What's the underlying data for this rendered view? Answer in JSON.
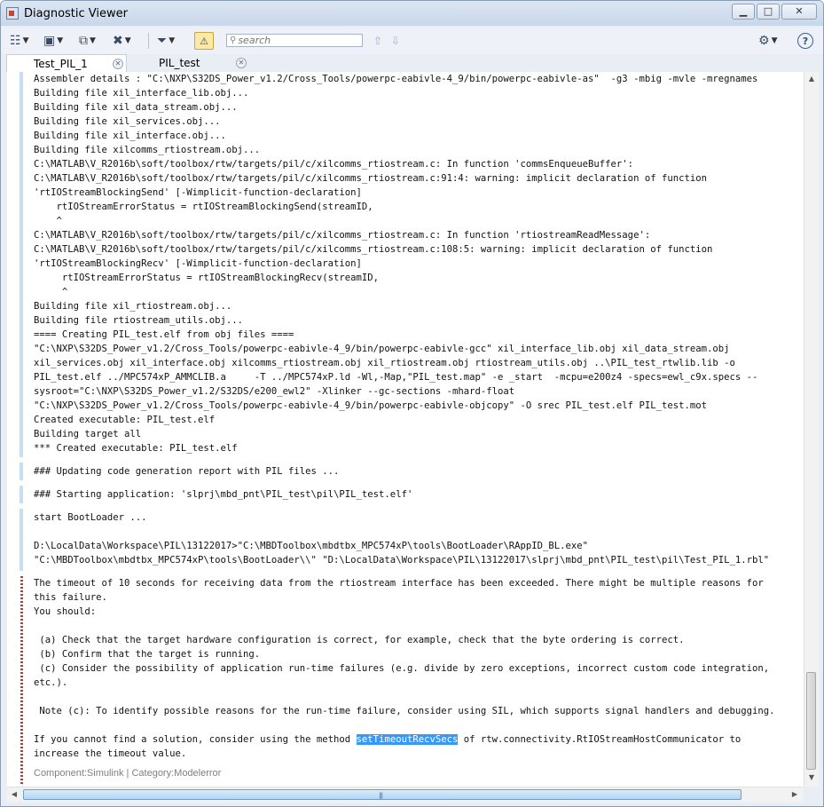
{
  "window": {
    "title": "Diagnostic Viewer"
  },
  "search": {
    "placeholder": "search"
  },
  "tabs": [
    {
      "label": "Test_PIL_1"
    },
    {
      "label": "PIL_test"
    }
  ],
  "blocks": {
    "build": [
      "Assembler details : \"C:\\NXP\\S32DS_Power_v1.2/Cross_Tools/powerpc-eabivle-4_9/bin/powerpc-eabivle-as\"  -g3 -mbig -mvle -mregnames",
      "Building file xil_interface_lib.obj...",
      "Building file xil_data_stream.obj...",
      "Building file xil_services.obj...",
      "Building file xil_interface.obj...",
      "Building file xilcomms_rtiostream.obj...",
      "C:\\MATLAB\\V_R2016b\\soft/toolbox/rtw/targets/pil/c/xilcomms_rtiostream.c: In function 'commsEnqueueBuffer':",
      "C:\\MATLAB\\V_R2016b\\soft/toolbox/rtw/targets/pil/c/xilcomms_rtiostream.c:91:4: warning: implicit declaration of function",
      "'rtIOStreamBlockingSend' [-Wimplicit-function-declaration]",
      "    rtIOStreamErrorStatus = rtIOStreamBlockingSend(streamID,",
      "    ^",
      "C:\\MATLAB\\V_R2016b\\soft/toolbox/rtw/targets/pil/c/xilcomms_rtiostream.c: In function 'rtiostreamReadMessage':",
      "C:\\MATLAB\\V_R2016b\\soft/toolbox/rtw/targets/pil/c/xilcomms_rtiostream.c:108:5: warning: implicit declaration of function",
      "'rtIOStreamBlockingRecv' [-Wimplicit-function-declaration]",
      "     rtIOStreamErrorStatus = rtIOStreamBlockingRecv(streamID,",
      "     ^",
      "Building file xil_rtiostream.obj...",
      "Building file rtiostream_utils.obj...",
      "==== Creating PIL_test.elf from obj files ====",
      "\"C:\\NXP\\S32DS_Power_v1.2/Cross_Tools/powerpc-eabivle-4_9/bin/powerpc-eabivle-gcc\" xil_interface_lib.obj xil_data_stream.obj",
      "xil_services.obj xil_interface.obj xilcomms_rtiostream.obj xil_rtiostream.obj rtiostream_utils.obj ..\\PIL_test_rtwlib.lib -o",
      "PIL_test.elf ../MPC574xP_AMMCLIB.a     -T ../MPC574xP.ld -Wl,-Map,\"PIL_test.map\" -e _start  -mcpu=e200z4 -specs=ewl_c9x.specs --",
      "sysroot=\"C:\\NXP\\S32DS_Power_v1.2/S32DS/e200_ewl2\" -Xlinker --gc-sections -mhard-float",
      "\"C:\\NXP\\S32DS_Power_v1.2/Cross_Tools/powerpc-eabivle-4_9/bin/powerpc-eabivle-objcopy\" -O srec PIL_test.elf PIL_test.mot",
      "Created executable: PIL_test.elf",
      "Building target all",
      "*** Created executable: PIL_test.elf"
    ],
    "report": "### Updating code generation report with PIL files ...",
    "start_app": "### Starting application: 'slprj\\mbd_pnt\\PIL_test\\pil\\PIL_test.elf'",
    "bootloader": [
      "start BootLoader ...",
      "",
      "D:\\LocalData\\Workspace\\PIL\\13122017>\"C:\\MBDToolbox\\mbdtbx_MPC574xP\\tools\\BootLoader\\RAppID_BL.exe\"",
      "\"C:\\MBDToolbox\\mbdtbx_MPC574xP\\tools\\BootLoader\\\\\" \"D:\\LocalData\\Workspace\\PIL\\13122017\\slprj\\mbd_pnt\\PIL_test\\pil\\Test_PIL_1.rbl\""
    ],
    "error": [
      "The timeout of 10 seconds for receiving data from the rtiostream interface has been exceeded. There might be multiple reasons for",
      "this failure.",
      "You should:",
      "",
      " (a) Check that the target hardware configuration is correct, for example, check that the byte ordering is correct.",
      " (b) Confirm that the target is running.",
      " (c) Consider the possibility of application run-time failures (e.g. divide by zero exceptions, incorrect custom code integration,",
      "etc.).",
      "",
      " Note (c): To identify possible reasons for the run-time failure, consider using SIL, which supports signal handlers and debugging.",
      ""
    ],
    "error_last": {
      "before": "If you cannot find a solution, consider using the method ",
      "link": "setTimeoutRecvSecs",
      "after": " of rtw.connectivity.RtIOStreamHostCommunicator to",
      "line2": "increase the timeout value."
    },
    "footer": "Component:Simulink | Category:Modelerror"
  }
}
